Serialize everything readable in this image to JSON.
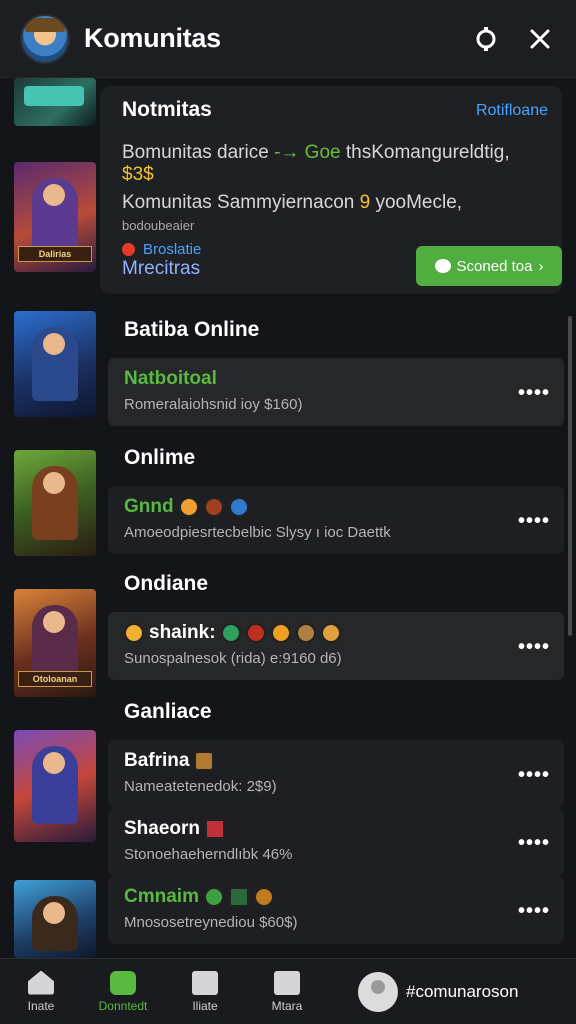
{
  "header": {
    "title": "Komunitas",
    "left_icon": "avatar",
    "action_icons": [
      "ring-icon",
      "close-icon"
    ]
  },
  "notification": {
    "title": "Notmitas",
    "link": "Rotifloane",
    "line1_prefix": "Bomunitas darice",
    "line1_highlight": "-→ Goe",
    "line1_suffix": "thsKomangureldtig,",
    "line1_end": "$3$",
    "line2": "Komunitas Sammyiernacon",
    "line2_emoji": "9",
    "line2_end": "yooMecle,",
    "sub": "bodoubeaier",
    "status": "Broslatie",
    "footer_label": "Mrecitras",
    "button_label": "Sconed toa"
  },
  "sections": [
    {
      "title": "Batiba Online"
    },
    {
      "title": "Onlime"
    },
    {
      "title": "Ondiane"
    },
    {
      "title": "Ganliace"
    }
  ],
  "rows": [
    {
      "name": "Natboitoal",
      "desc": "Romeralaiohsnid ioy $160)",
      "color": "green"
    },
    {
      "name": "Gnnd",
      "desc": "Amoeodpiesrtecbelbic Slysy ı ioc Daettk",
      "color": "green"
    },
    {
      "name": "shaink:",
      "desc": "Sunospalnesok (rida) e:9160 d6)",
      "color": "white"
    },
    {
      "name": "Bafrina",
      "desc": "Nameatetenedok: 2$9)",
      "color": "white"
    },
    {
      "name": "Shaeorn",
      "desc": "Stonoehaeherndlıbk 46%",
      "color": "white"
    },
    {
      "name": "Cmnaim",
      "desc": "Mnososetreynediou $60$)",
      "color": "green"
    }
  ],
  "more_label": "••••",
  "bottom_nav": [
    {
      "label": "Inate",
      "icon": "home-icon"
    },
    {
      "label": "Donntedt",
      "icon": "chat-icon",
      "active": true
    },
    {
      "label": "Iliate",
      "icon": "clipboard-icon"
    },
    {
      "label": "Mtara",
      "icon": "robot-icon"
    }
  ],
  "profile": {
    "name": "#comunaroson",
    "icon": "profile-avatar-icon"
  },
  "art_labels": [
    "Dalirias",
    "Otoloanan"
  ],
  "colors": {
    "accent_green": "#59b941",
    "link_blue": "#4aa3ff",
    "bg": "#141518"
  }
}
